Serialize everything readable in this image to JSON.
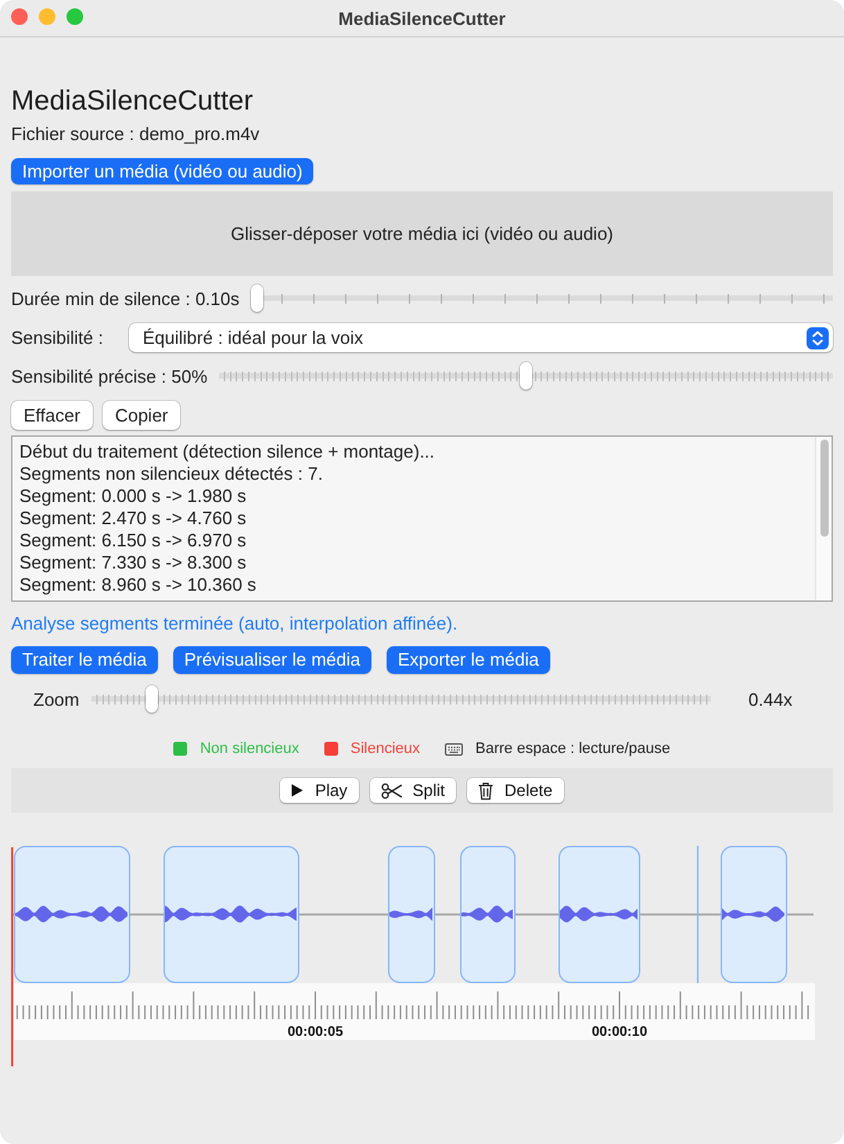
{
  "window": {
    "title": "MediaSilenceCutter"
  },
  "app": {
    "title": "MediaSilenceCutter",
    "source_file": "Fichier source : demo_pro.m4v",
    "import_button": "Importer un média (vidéo ou audio)"
  },
  "drop_zone": {
    "text": "Glisser-déposer votre média ici (vidéo ou audio)"
  },
  "min_silence": {
    "label": "Durée min de silence : 0.10s",
    "level": 0
  },
  "sensitivity": {
    "label": "Sensibilité :",
    "value": "Équilibré : idéal pour la voix"
  },
  "fine_sensitivity": {
    "label": "Sensibilité précise : 50%",
    "level": 0.5
  },
  "log_buttons": [
    "Effacer",
    "Copier"
  ],
  "log": {
    "lines": [
      "Début du traitement (détection silence + montage)...",
      "Segments non silencieux détectés : 7.",
      "Segment: 0.000 s -> 1.980 s",
      "Segment: 2.470 s -> 4.760 s",
      "Segment: 6.150 s -> 6.970 s",
      "Segment: 7.330 s -> 8.300 s",
      "Segment: 8.960 s -> 10.360 s"
    ]
  },
  "status": "Analyse segments terminée (auto, interpolation affinée).",
  "actions": [
    "Traiter le média",
    "Prévisualiser le média",
    "Exporter le média"
  ],
  "zoom": {
    "label": "Zoom",
    "level": 0.09,
    "value": "0.44x"
  },
  "legend": {
    "items": [
      {
        "label": "Non silencieux",
        "color": "#2dbe48"
      },
      {
        "label": "Silencieux",
        "color": "#f5403a"
      }
    ],
    "shortcut_hint": "Barre espace : lecture/pause"
  },
  "toolbar": [
    {
      "kind": "play",
      "label": "Play"
    },
    {
      "kind": "split",
      "label": "Split"
    },
    {
      "kind": "delete",
      "label": "Delete"
    }
  ],
  "timeline": {
    "ruler_labels": [
      "00:00:05",
      "00:00:10"
    ]
  }
}
